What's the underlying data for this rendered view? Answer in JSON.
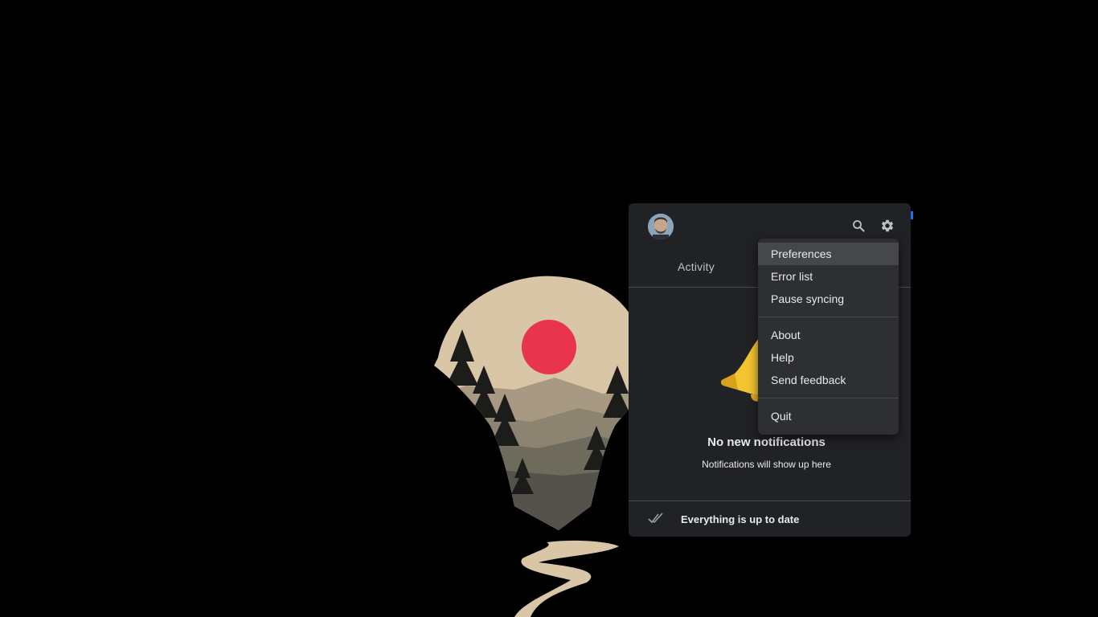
{
  "panel": {
    "tabs": {
      "activity": "Activity"
    },
    "empty_state": {
      "title": "No new notifications",
      "subtitle": "Notifications will show up here"
    },
    "footer": {
      "status": "Everything is up to date"
    }
  },
  "menu": {
    "groups": [
      [
        "Preferences",
        "Error list",
        "Pause syncing"
      ],
      [
        "About",
        "Help",
        "Send feedback"
      ],
      [
        "Quit"
      ]
    ],
    "active_item": "Preferences"
  },
  "icons": {
    "header": [
      "avatar",
      "search-icon",
      "gear-icon"
    ],
    "footer": "double-check-icon",
    "empty_state": "bell-icon"
  },
  "colors": {
    "panel_bg": "#212225",
    "menu_bg": "#2e2f32",
    "menu_active_bg": "#45474a",
    "sun": "#e8344e",
    "bell": "#f4c430"
  }
}
